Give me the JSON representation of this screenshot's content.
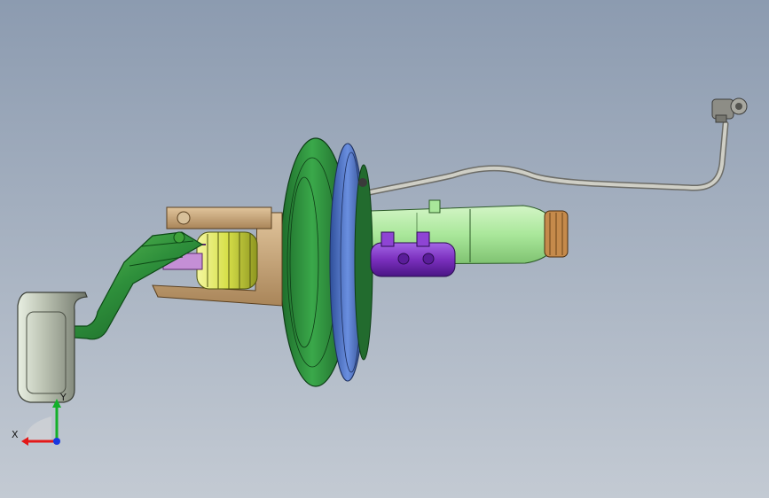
{
  "viewport": {
    "background_top": "#8c9bb0",
    "background_bottom": "#c3cad3"
  },
  "model": {
    "parts": [
      {
        "name": "brake-pedal",
        "color": "#3fa23a"
      },
      {
        "name": "pedal-pad",
        "color": "#b9c0b0"
      },
      {
        "name": "mounting-bracket",
        "color": "#c9a77e"
      },
      {
        "name": "return-spring",
        "color": "#d7e04a"
      },
      {
        "name": "vacuum-booster",
        "color": "#2e8f3b"
      },
      {
        "name": "booster-ring",
        "color": "#4a6fc1"
      },
      {
        "name": "master-cylinder",
        "color": "#7a2fbd"
      },
      {
        "name": "brake-fluid-reservoir",
        "color": "#a9e79a"
      },
      {
        "name": "vacuum-hose",
        "color": "#b8b8b0"
      },
      {
        "name": "check-valve-fitting",
        "color": "#8d8d86"
      }
    ]
  },
  "triad": {
    "x_label": "X",
    "y_label": "Y",
    "x_color": "#e31818",
    "y_color": "#13b02a",
    "z_color": "#1838e0"
  }
}
